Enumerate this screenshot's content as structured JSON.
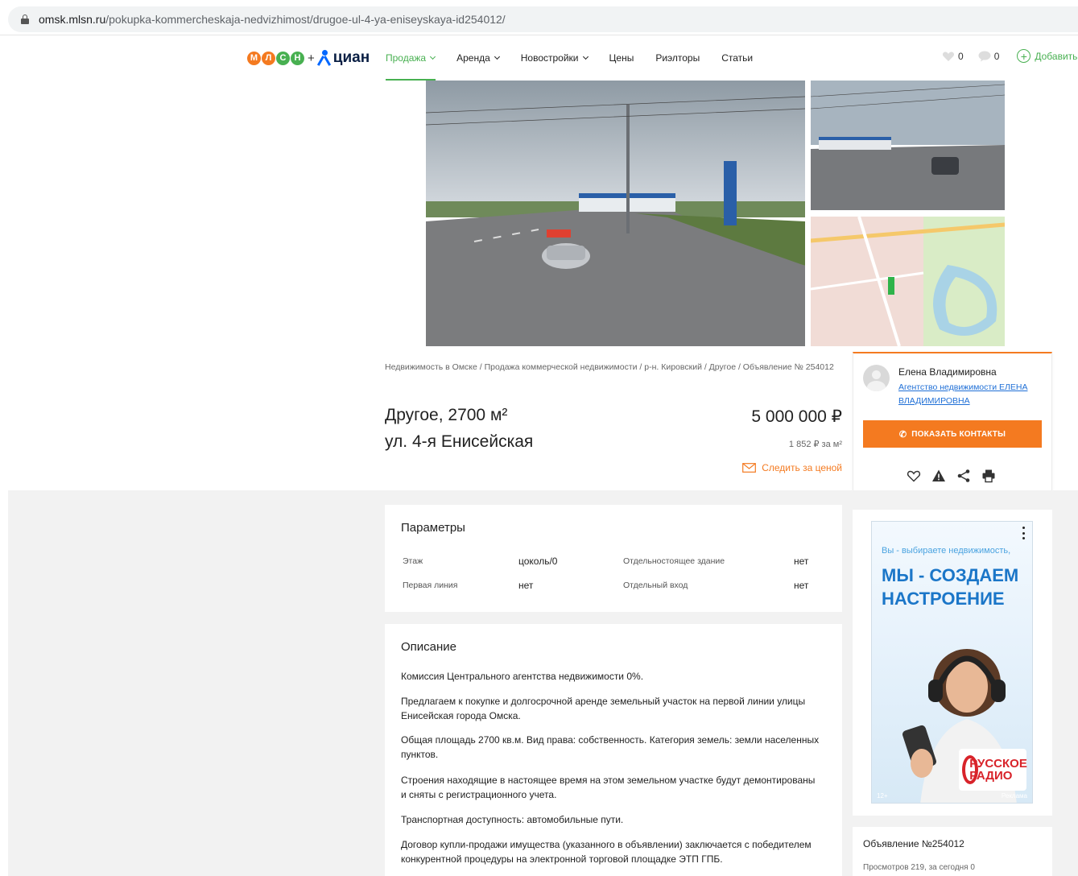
{
  "browser": {
    "url_host": "omsk.mlsn.ru",
    "url_path": "/pokupka-kommercheskaja-nedvizhimost/drugoe-ul-4-ya-eniseyskaya-id254012/"
  },
  "header": {
    "logo_letters": [
      "М",
      "Л",
      "С",
      "Н"
    ],
    "logo_colors": [
      "#f47a20",
      "#f47a20",
      "#48b051",
      "#48b051"
    ],
    "logo_plus": "+",
    "logo_partner": "циан",
    "nav": [
      {
        "label": "Продажа",
        "dropdown": true,
        "active": true
      },
      {
        "label": "Аренда",
        "dropdown": true,
        "active": false
      },
      {
        "label": "Новостройки",
        "dropdown": true,
        "active": false
      },
      {
        "label": "Цены",
        "dropdown": false,
        "active": false
      },
      {
        "label": "Риэлторы",
        "dropdown": false,
        "active": false
      },
      {
        "label": "Статьи",
        "dropdown": false,
        "active": false
      }
    ],
    "favorites_count": "0",
    "messages_count": "0",
    "add_label": "Добавить"
  },
  "listing": {
    "breadcrumb": "Недвижимость в Омске / Продажа коммерческой недвижимости / р-н. Кировский / Другое / Объявление № 254012",
    "title": "Другое, 2700 м²",
    "address": "ул. 4-я Енисейская",
    "price": "5 000 000 ₽",
    "price_per_m2": "1 852 ₽ за м²",
    "watch_price": "Следить за ценой"
  },
  "contact": {
    "agent_name": "Елена Владимировна",
    "agency": "Агентство недвижимости ЕЛЕНА ВЛАДИМИРОВНА",
    "show_contacts": "ПОКАЗАТЬ КОНТАКТЫ",
    "actions": [
      "heart-icon",
      "warning-icon",
      "share-icon",
      "print-icon"
    ]
  },
  "params": {
    "title": "Параметры",
    "rows": [
      {
        "label": "Этаж",
        "value": "цоколь/0"
      },
      {
        "label": "Отдельностоящее здание",
        "value": "нет"
      },
      {
        "label": "Первая линия",
        "value": "нет"
      },
      {
        "label": "Отдельный вход",
        "value": "нет"
      }
    ]
  },
  "description": {
    "title": "Описание",
    "paragraphs": [
      "Комиссия Центрального агентства недвижимости 0%.",
      "Предлагаем к покупке и долгосрочной аренде земельный участок на первой линии улицы Енисейская города Омска.",
      "Общая площадь 2700 кв.м. Вид права: собственность. Категория земель: земли населенных пунктов.",
      "Строения находящие в настоящее время на этом земельном участке будут демонтированы и сняты с регистрационного учета.",
      "Транспортная доступность: автомобильные пути.",
      "Договор купли-продажи имущества (указанного в объявлении) заключается с победителем конкурентной процедуры на электронной торговой площадке ЭТП ГПБ."
    ]
  },
  "ad": {
    "small_text": "Вы - выбираете недвижимость,",
    "big_text": "МЫ - СОЗДАЕМ НАСТРОЕНИЕ",
    "logo_text": "РУССКОЕ РАДИО",
    "age": "12+",
    "label": "Реклама"
  },
  "listing_info": {
    "number": "Объявление №254012",
    "views": "Просмотров 219, за сегодня 0"
  },
  "colors": {
    "accent_green": "#48b051",
    "accent_orange": "#f47a20",
    "link_blue": "#1f6fd6"
  }
}
